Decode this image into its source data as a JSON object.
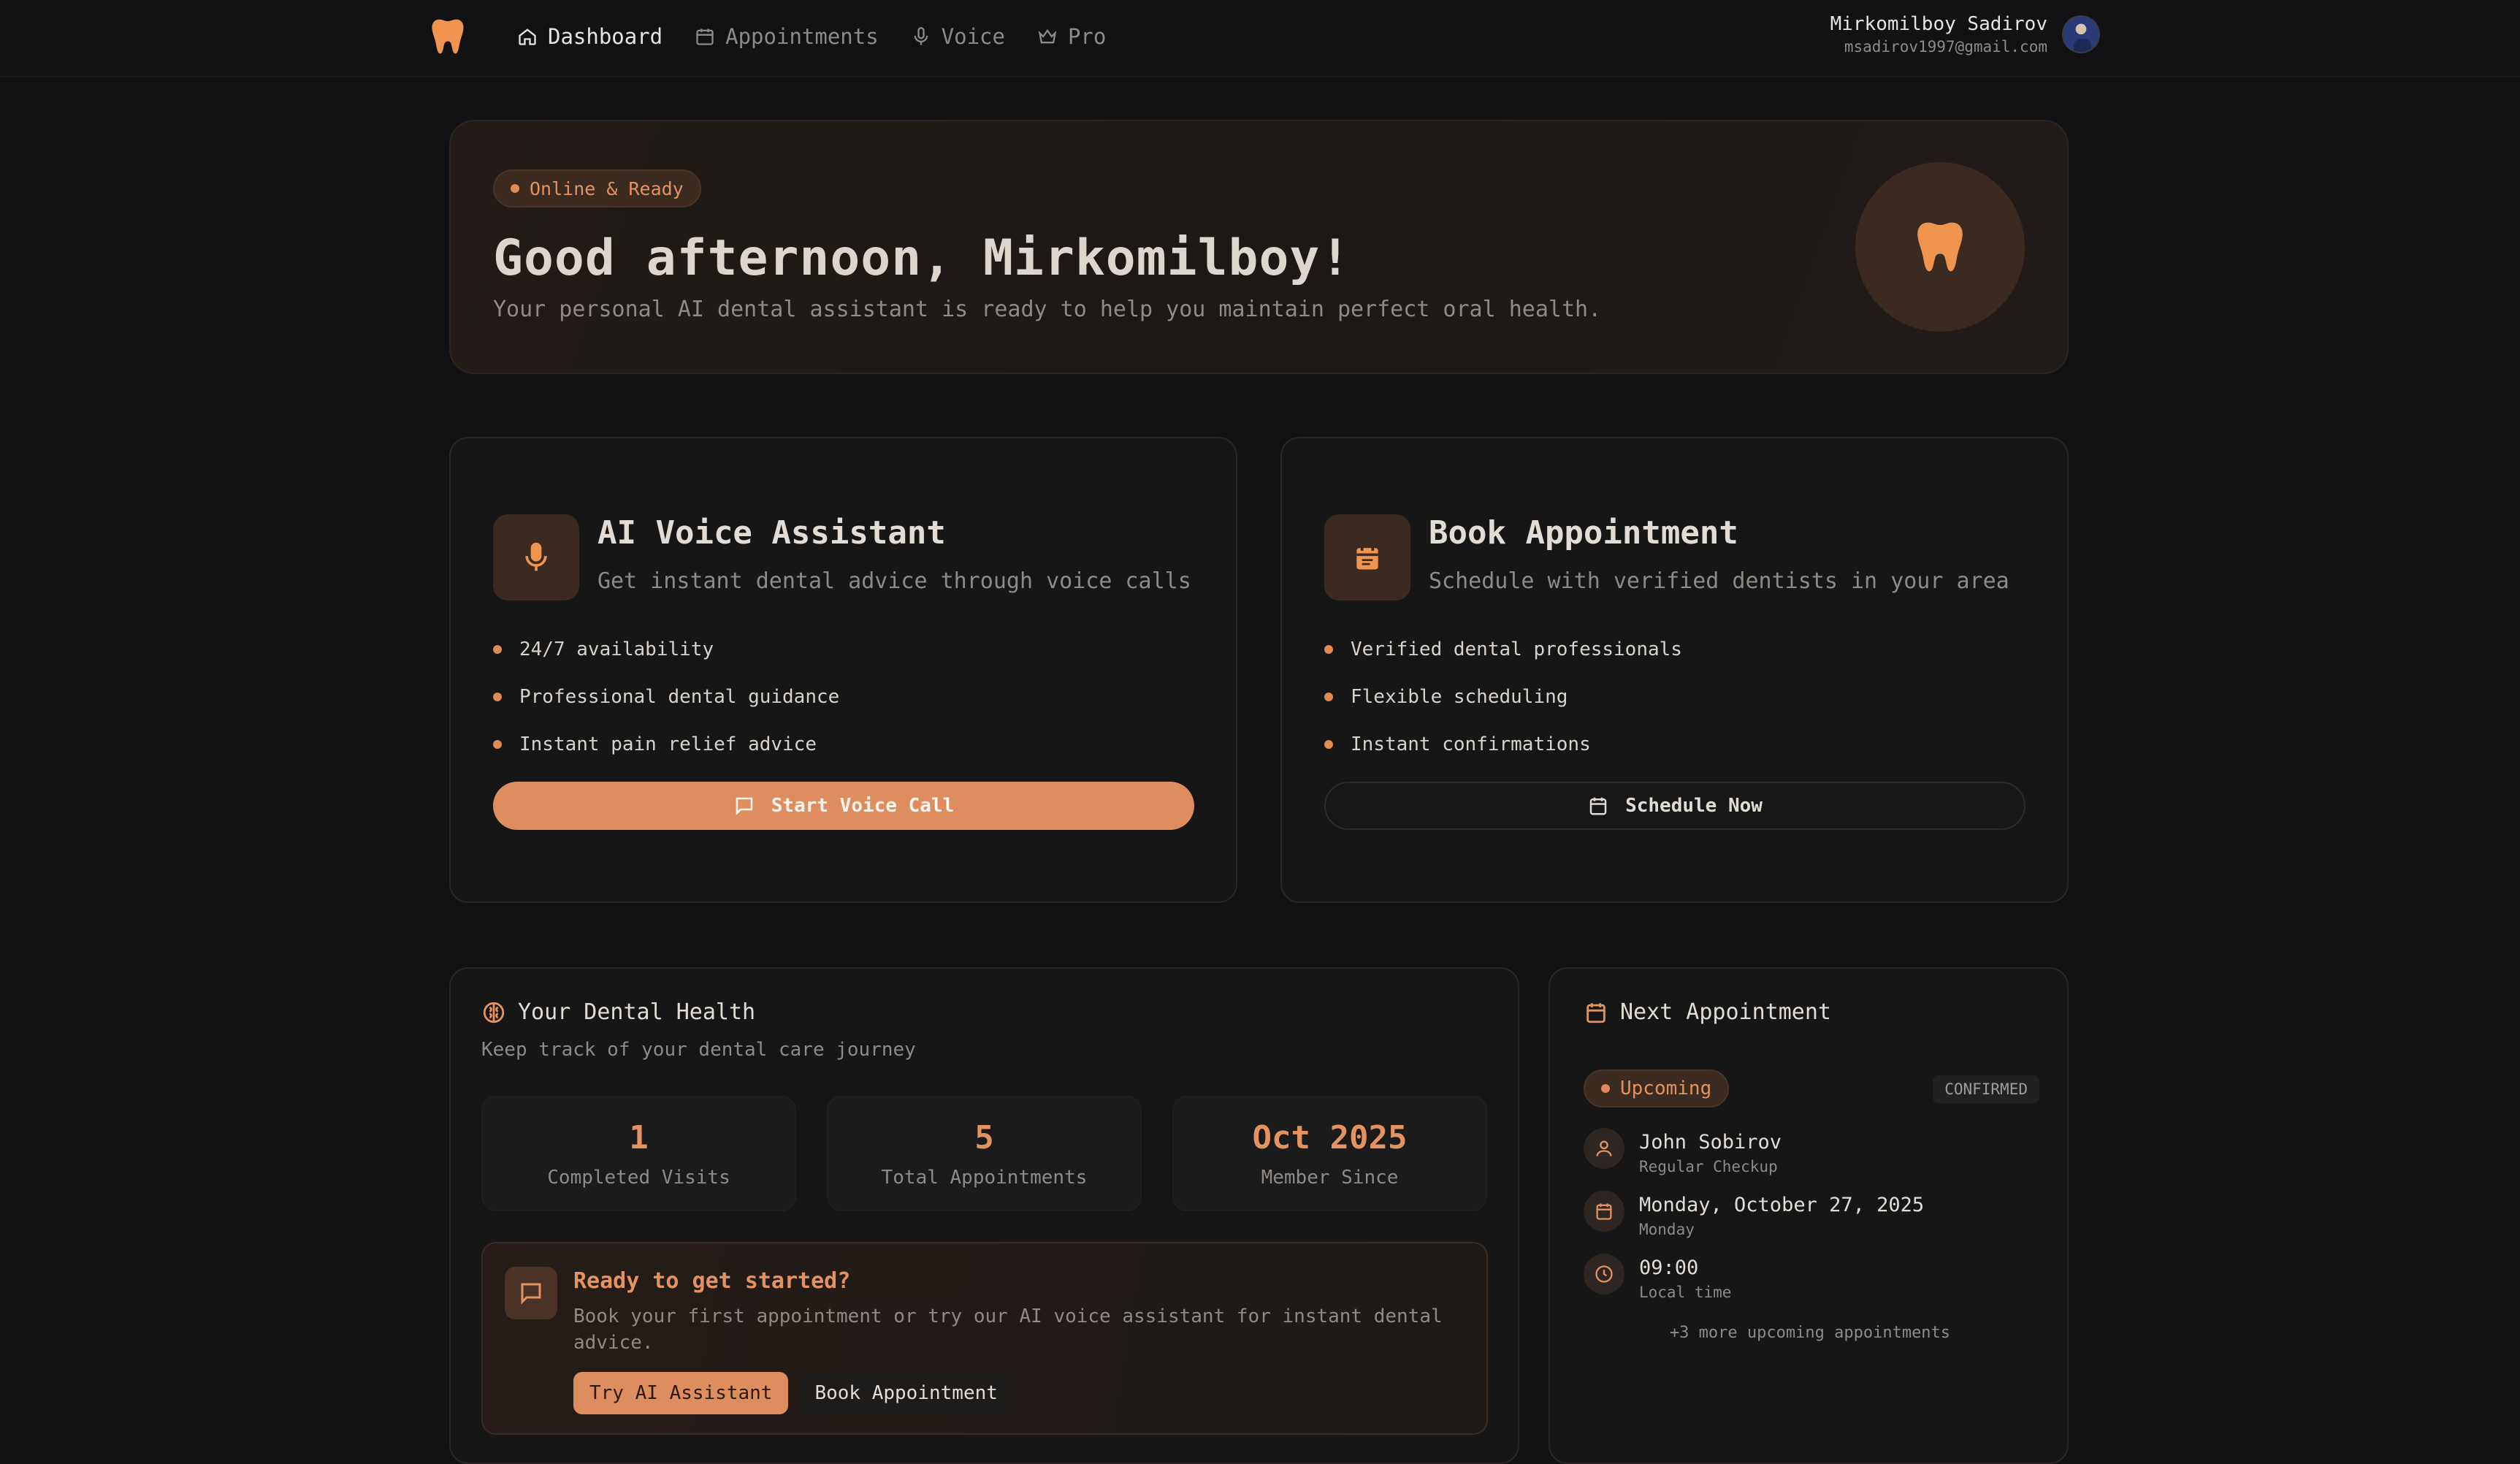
{
  "nav": {
    "items": [
      {
        "label": "Dashboard",
        "icon": "home-icon",
        "active": true
      },
      {
        "label": "Appointments",
        "icon": "calendar-icon",
        "active": false
      },
      {
        "label": "Voice",
        "icon": "mic-icon",
        "active": false
      },
      {
        "label": "Pro",
        "icon": "crown-icon",
        "active": false
      }
    ],
    "user": {
      "name": "Mirkomilboy Sadirov",
      "email": "msadirov1997@gmail.com"
    }
  },
  "hero": {
    "status": "Online & Ready",
    "greeting": "Good afternoon, Mirkomilboy!",
    "subtitle": "Your personal AI dental assistant is ready to help you maintain perfect oral health."
  },
  "voice_card": {
    "title": "AI Voice Assistant",
    "desc": "Get instant dental advice through voice calls",
    "features": [
      "24/7 availability",
      "Professional dental guidance",
      "Instant pain relief advice"
    ],
    "button": "Start Voice Call"
  },
  "book_card": {
    "title": "Book Appointment",
    "desc": "Schedule with verified dentists in your area",
    "features": [
      "Verified dental professionals",
      "Flexible scheduling",
      "Instant confirmations"
    ],
    "button": "Schedule Now"
  },
  "health": {
    "title": "Your Dental Health",
    "subtitle": "Keep track of your dental care journey",
    "stats": [
      {
        "value": "1",
        "label": "Completed Visits"
      },
      {
        "value": "5",
        "label": "Total Appointments"
      },
      {
        "value": "Oct 2025",
        "label": "Member Since"
      }
    ],
    "cta": {
      "title": "Ready to get started?",
      "text": "Book your first appointment or try our AI voice assistant for instant dental advice.",
      "primary": "Try AI Assistant",
      "secondary": "Book Appointment"
    }
  },
  "next": {
    "title": "Next Appointment",
    "status": "Upcoming",
    "badge": "CONFIRMED",
    "doctor": "John Sobirov",
    "type": "Regular Checkup",
    "date": "Monday, October 27, 2025",
    "weekday": "Monday",
    "time": "09:00",
    "time_note": "Local time",
    "more": "+3 more upcoming appointments"
  },
  "colors": {
    "accent": "#dd8d5e",
    "background": "#121214",
    "card": "#161617"
  }
}
